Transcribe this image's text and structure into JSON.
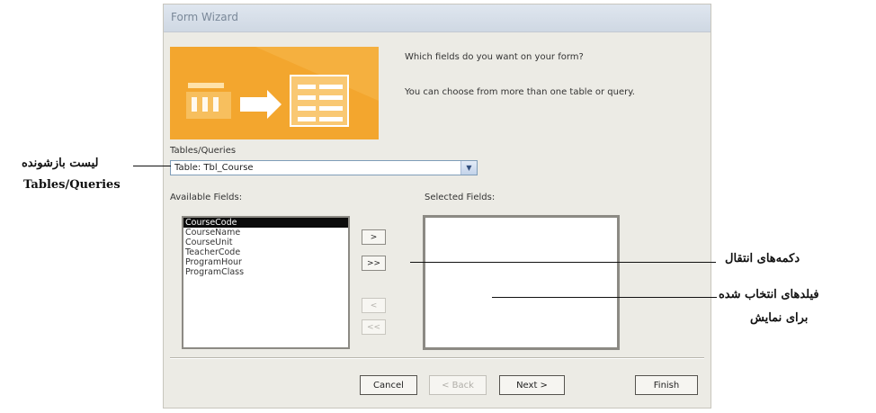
{
  "dialog": {
    "title": "Form Wizard",
    "question": "Which fields do you want on your form?",
    "hint": "You can choose from more than one table or query.",
    "tables_label": "Tables/Queries",
    "table_value": "Table: Tbl_Course",
    "available_label": "Available Fields:",
    "selected_label": "Selected Fields:",
    "available_fields": [
      "CourseCode",
      "CourseName",
      "CourseUnit",
      "TeacherCode",
      "ProgramHour",
      "ProgramClass"
    ],
    "selected_fields": [],
    "move_buttons": [
      ">",
      ">>",
      "<",
      "<<"
    ],
    "buttons": {
      "cancel": "Cancel",
      "back": "< Back",
      "next": "Next >",
      "finish": "Finish"
    }
  },
  "annotations": {
    "combo_label_line1": "لیست بازشونده",
    "combo_label_line2": "Tables/Queries",
    "move_buttons_label": "دکمه‌های انتقال",
    "selected_fields_label_line1": "فیلدهای انتخاب شده",
    "selected_fields_label_line2": "برای نمایش"
  },
  "colors": {
    "banner": "#f3a62e",
    "selection": "#0b0b0b"
  }
}
